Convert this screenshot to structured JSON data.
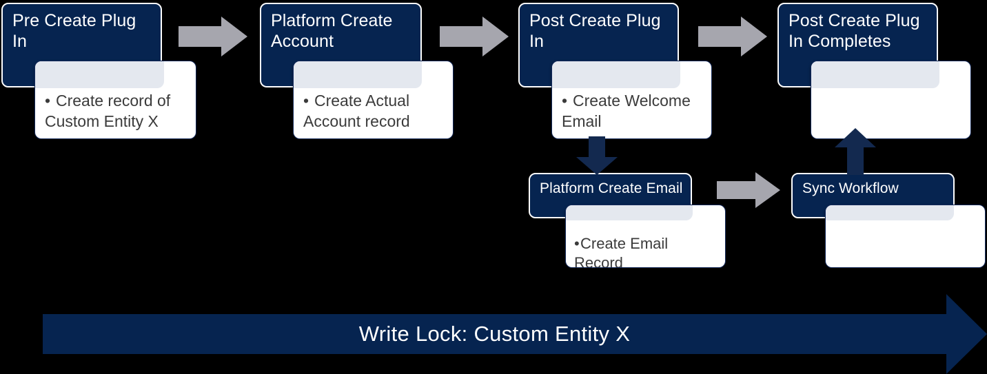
{
  "diagram": {
    "title": "Write Lock: Custom Entity X",
    "colors": {
      "navy": "#062450",
      "navy_banner": "#062450",
      "gray_arrow": "#a6a6ae",
      "card_white": "#ffffff",
      "card_shade": "#e4e8ef",
      "background": "#000000",
      "body_text": "#3b3b3b"
    },
    "top_row": [
      {
        "id": "pre-create-plug-in",
        "title": "Pre Create Plug In",
        "detail": "Create record of Custom Entity X",
        "bullet": "•"
      },
      {
        "id": "platform-create-account",
        "title": "Platform Create Account",
        "detail": "Create Actual Account record",
        "bullet": "•"
      },
      {
        "id": "post-create-plug-in",
        "title": "Post Create Plug In",
        "detail": "Create Welcome Email",
        "bullet": "•"
      },
      {
        "id": "post-create-plug-in-completes",
        "title": "Post Create Plug In Completes",
        "detail": "",
        "bullet": ""
      }
    ],
    "bottom_row": [
      {
        "id": "platform-create-email",
        "title": "Platform Create Email",
        "detail": "Create Email Record",
        "bullet": "•"
      },
      {
        "id": "sync-workflow",
        "title": "Sync Workflow",
        "detail": "",
        "bullet": ""
      }
    ],
    "connectors": [
      {
        "id": "arrow-pre-to-platform",
        "kind": "right",
        "color": "#a6a6ae"
      },
      {
        "id": "arrow-platform-to-post",
        "kind": "right",
        "color": "#a6a6ae"
      },
      {
        "id": "arrow-post-to-completes",
        "kind": "right",
        "color": "#a6a6ae"
      },
      {
        "id": "arrow-post-down-to-email",
        "kind": "down",
        "color": "#13294f"
      },
      {
        "id": "arrow-email-to-sync",
        "kind": "right",
        "color": "#a6a6ae"
      },
      {
        "id": "arrow-sync-up-to-completes",
        "kind": "up",
        "color": "#13294f"
      }
    ],
    "banner": {
      "label": "Write Lock: Custom Entity X",
      "shape": "right-arrow-block",
      "color": "#062450"
    }
  }
}
